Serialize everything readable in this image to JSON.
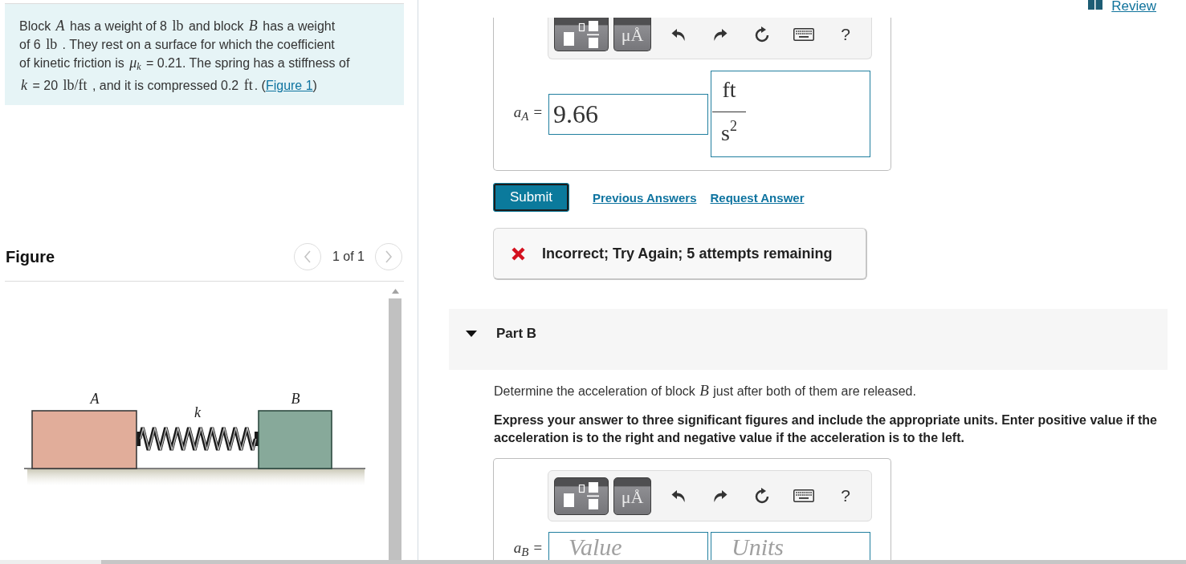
{
  "review_link": {
    "label": "Review"
  },
  "problem": {
    "lines": [
      [
        {
          "kind": "text",
          "text": "Block "
        },
        {
          "kind": "var",
          "text": "A"
        },
        {
          "kind": "text",
          "text": " has a weight of 8 "
        },
        {
          "kind": "unit",
          "text": "lb"
        },
        {
          "kind": "text",
          "text": " and block "
        },
        {
          "kind": "var",
          "text": "B"
        },
        {
          "kind": "text",
          "text": " has a weight"
        }
      ],
      [
        {
          "kind": "text",
          "text": "of 6 "
        },
        {
          "kind": "unit",
          "text": "lb"
        },
        {
          "kind": "text",
          "text": " . They rest on a surface for which the coefficient"
        }
      ],
      [
        {
          "kind": "text",
          "text": "of kinetic friction is "
        },
        {
          "kind": "var",
          "text": "μ$_{k}$"
        },
        {
          "kind": "text",
          "text": " = 0.21. The spring has a stiffness of"
        }
      ],
      [
        {
          "kind": "var",
          "text": "k"
        },
        {
          "kind": "text",
          "text": " = 20 "
        },
        {
          "kind": "unit",
          "text": "lb/ft"
        },
        {
          "kind": "text",
          "text": " , and it is compressed 0.2 "
        },
        {
          "kind": "unit",
          "text": "ft"
        },
        {
          "kind": "text",
          "text": ". ("
        },
        {
          "kind": "link",
          "text": "Figure 1"
        },
        {
          "kind": "text",
          "text": ")"
        }
      ]
    ]
  },
  "figure": {
    "title": "Figure",
    "pager": "1 of 1",
    "block_labels": [
      "A",
      "B"
    ],
    "spring_label": "k"
  },
  "part_a": {
    "toolbar": [
      {
        "kind": "templates"
      },
      {
        "kind": "symbols",
        "label": "μÅ"
      },
      {
        "kind": "undo"
      },
      {
        "kind": "redo"
      },
      {
        "kind": "reset"
      },
      {
        "kind": "keyboard"
      },
      {
        "kind": "help",
        "label": "?"
      }
    ],
    "answer": {
      "variable": "a$_{A}$ =",
      "value": "9.66",
      "units": {
        "numerator": "ft",
        "denominator": "s$^{2}$"
      }
    },
    "submit": "Submit",
    "links": [
      "Previous Answers",
      "Request Answer"
    ],
    "feedback": {
      "correct": false,
      "text": "Incorrect; Try Again; 5 attempts remaining"
    }
  },
  "part_b": {
    "title": "Part B",
    "expanded": true,
    "prompt": [
      {
        "kind": "text",
        "text": "Determine the acceleration of block "
      },
      {
        "kind": "var",
        "text": "B"
      },
      {
        "kind": "text",
        "text": " just after both of them are released."
      }
    ],
    "instructions": "Express your answer to three significant figures and include the appropriate units. Enter positive value if the acceleration is to the right and negative value if the acceleration is to the left.",
    "toolbar": [
      {
        "kind": "templates"
      },
      {
        "kind": "symbols",
        "label": "μÅ"
      },
      {
        "kind": "undo"
      },
      {
        "kind": "redo"
      },
      {
        "kind": "reset"
      },
      {
        "kind": "keyboard"
      },
      {
        "kind": "help",
        "label": "?"
      }
    ],
    "answer": {
      "variable": "a$_{B}$ =",
      "value_placeholder": "Value",
      "units_placeholder": "Units"
    }
  }
}
